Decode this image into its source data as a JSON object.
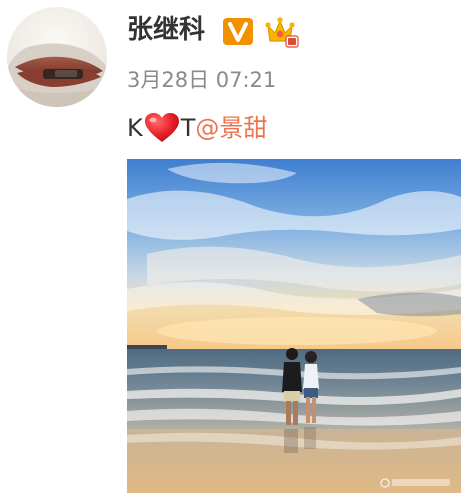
{
  "post": {
    "author_name": "张继科",
    "timestamp": "3月28日 07:21",
    "text_before": "K",
    "heart_icon": "red-heart-emoji",
    "text_after": "T",
    "mention": "@景甜",
    "badges": [
      "verified-v-badge",
      "crown-member-badge"
    ],
    "image": "beach-couple-sunrise-photo"
  },
  "colors": {
    "name": "#333333",
    "time": "#8a8a8a",
    "mention": "#eb7350",
    "verified": "#f29100",
    "heart": "#e8202a"
  }
}
